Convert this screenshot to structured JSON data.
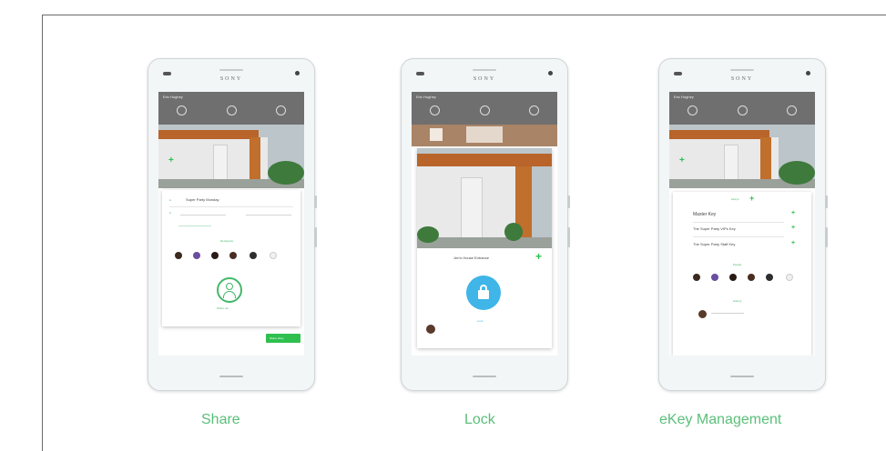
{
  "captions": [
    "Share",
    "Lock",
    "eKey Management"
  ],
  "phone_brand": "SONY",
  "app": {
    "title": "Eric Hughey",
    "nav": [
      "",
      "",
      ""
    ]
  },
  "share_screen": {
    "key_name": "Super Party Monday",
    "field_from": "",
    "field_to": "",
    "people_heading": "Recipients",
    "share_label": "Share via",
    "fab_label": "Share eKey"
  },
  "lock_screen": {
    "lock_name": "Jen's House Entrance",
    "lock_status": "Lock"
  },
  "ekey_screen": {
    "ekeys_heading": "eKeys",
    "keys": [
      {
        "name": "Master Key",
        "sub": ""
      },
      {
        "name": "The Super Party VIPs Key",
        "sub": ""
      },
      {
        "name": "The Super Party Staff Key",
        "sub": ""
      }
    ],
    "people_heading": "People",
    "history_heading": "History"
  },
  "colors": {
    "accent": "#43b86a",
    "lock_button": "#3fb5e8",
    "appbar": "#6f6f6f"
  },
  "icons": [
    "plus-icon",
    "lock-icon",
    "person-icon"
  ]
}
